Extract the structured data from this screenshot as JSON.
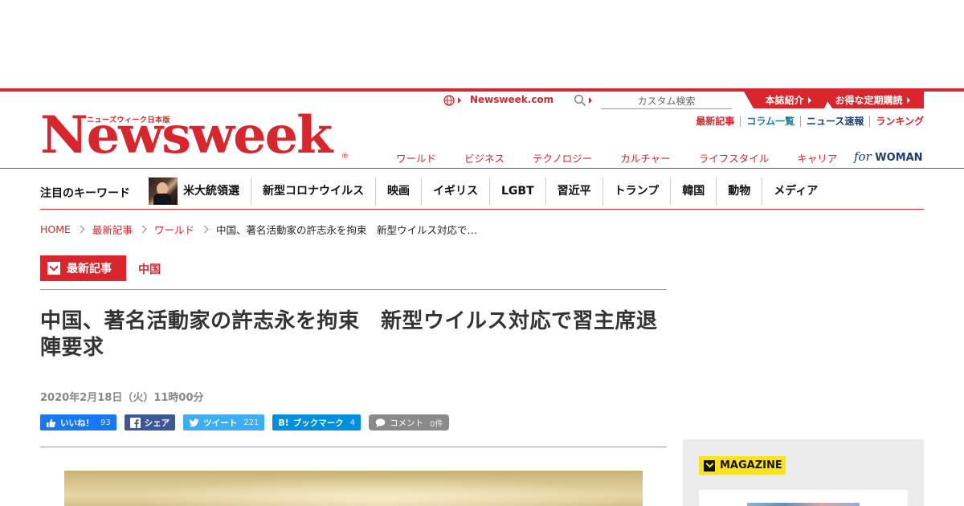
{
  "brand": {
    "logo_jp": "ニューズウィーク日本版",
    "logo_main": "Newsweek",
    "logo_reg": "®",
    "colors": {
      "accent": "#d9262c",
      "navy": "#1d3d6d",
      "teal": "#1a7a9c"
    }
  },
  "header": {
    "site_link": "Newsweek.com",
    "search_placeholder": "カスタム検索",
    "tab_about": "本誌紹介",
    "tab_subscribe": "お得な定期購読",
    "util_links": {
      "latest": "最新記事",
      "column": "コラム一覧",
      "news": "ニュース速報",
      "ranking": "ランキング"
    },
    "categories": [
      "ワールド",
      "ビジネス",
      "テクノロジー",
      "カルチャー",
      "ライフスタイル",
      "キャリア"
    ],
    "forwoman_for": "for",
    "forwoman_woman": "WOMAN"
  },
  "keywords": {
    "title": "注目のキーワード",
    "items": [
      "米大統領選",
      "新型コロナウイルス",
      "映画",
      "イギリス",
      "LGBT",
      "習近平",
      "トランプ",
      "韓国",
      "動物",
      "メディア"
    ]
  },
  "breadcrumb": {
    "home": "HOME",
    "latest": "最新記事",
    "world": "ワールド",
    "current": "中国、著名活動家の許志永を拘束　新型ウイルス対応で…"
  },
  "article": {
    "badge": "最新記事",
    "category": "中国",
    "headline": "中国、著名活動家の許志永を拘束　新型ウイルス対応で習主席退陣要求",
    "date": "2020年2月18日（火）11時00分"
  },
  "share": {
    "like_label": "いいね！",
    "like_count": "93",
    "fb_label": "シェア",
    "tweet_label": "ツイート",
    "tweet_count": "221",
    "hatena_label": "ブックマーク",
    "hatena_count": "4",
    "comment_label": "コメント",
    "comment_count": "0件"
  },
  "sidebar": {
    "magazine_label": "MAGAZINE"
  }
}
